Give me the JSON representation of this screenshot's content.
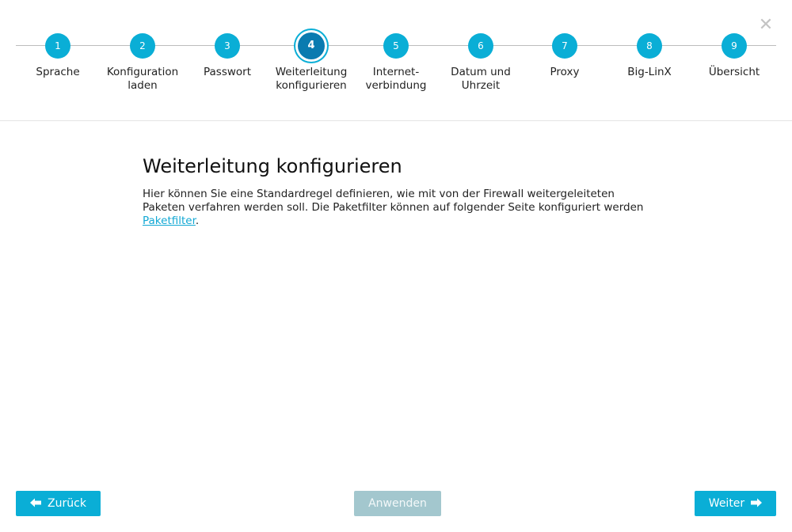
{
  "close_icon": "✕",
  "steps": [
    {
      "number": "1",
      "label_line1": "Sprache",
      "label_line2": ""
    },
    {
      "number": "2",
      "label_line1": "Konfiguration",
      "label_line2": "laden"
    },
    {
      "number": "3",
      "label_line1": "Passwort",
      "label_line2": ""
    },
    {
      "number": "4",
      "label_line1": "Weiterleitung",
      "label_line2": "konfigurieren"
    },
    {
      "number": "5",
      "label_line1": "Internet-",
      "label_line2": "verbindung"
    },
    {
      "number": "6",
      "label_line1": "Datum und",
      "label_line2": "Uhrzeit"
    },
    {
      "number": "7",
      "label_line1": "Proxy",
      "label_line2": ""
    },
    {
      "number": "8",
      "label_line1": "Big-LinX",
      "label_line2": ""
    },
    {
      "number": "9",
      "label_line1": "Übersicht",
      "label_line2": ""
    }
  ],
  "active_step": 4,
  "content": {
    "title": "Weiterleitung konfigurieren",
    "description": "Hier können Sie eine Standardregel definieren, wie mit von der Firewall weitergeleiteten Paketen verfahren werden soll. Die Paketfilter können auf folgender Seite konfiguriert werden",
    "link_text": "Paketfilter",
    "trailing_text": "."
  },
  "buttons": {
    "back_label": "Zurück",
    "apply_label": "Anwenden",
    "next_label": "Weiter"
  },
  "colors": {
    "accent": "#0aaed6",
    "active_step": "#0a7bb0",
    "disabled_button": "#a3c7ce"
  }
}
